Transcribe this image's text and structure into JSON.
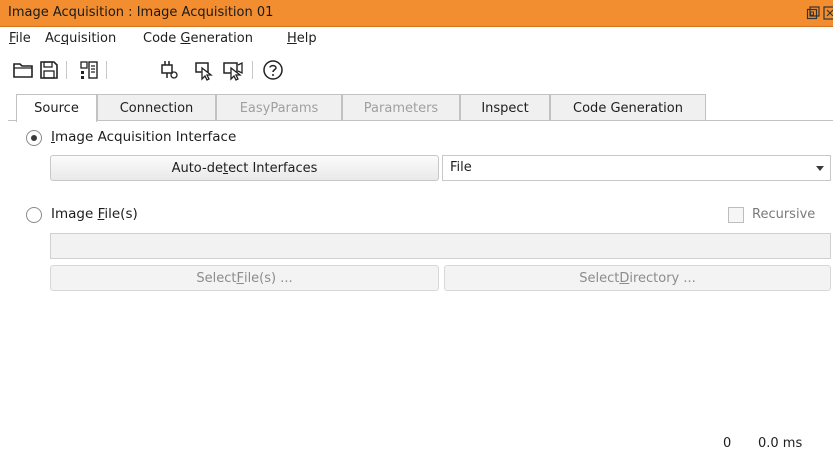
{
  "window": {
    "title": "Image Acquisition : Image Acquisition 01"
  },
  "menu": {
    "items": [
      {
        "label": "File",
        "mnemonic": "F"
      },
      {
        "label": "Acquisition",
        "mnemonic": "q"
      },
      {
        "label": "Code Generation",
        "mnemonic": "G"
      },
      {
        "label": "Help",
        "mnemonic": "H"
      }
    ]
  },
  "toolbar": {
    "icons": [
      "folder-open-icon",
      "save-icon",
      "document-layout-icon",
      "connect-plug-icon",
      "grab-single-icon",
      "grab-live-icon",
      "help-icon"
    ]
  },
  "tabs": [
    {
      "label": "Source",
      "state": "active"
    },
    {
      "label": "Connection",
      "state": "enabled"
    },
    {
      "label": "EasyParams",
      "state": "disabled"
    },
    {
      "label": "Parameters",
      "state": "disabled"
    },
    {
      "label": "Inspect",
      "state": "enabled"
    },
    {
      "label": "Code Generation",
      "state": "enabled"
    }
  ],
  "source": {
    "interface_radio": {
      "label_pre": "Image Acquisition Interface",
      "selected": true
    },
    "autodetect_button": {
      "pre": "Auto-de",
      "mn": "t",
      "post": "ect Interfaces"
    },
    "interface_combo": {
      "value": "File"
    },
    "files_radio": {
      "pre": "Image ",
      "mn": "F",
      "post": "ile(s)",
      "selected": false
    },
    "recursive_checkbox": {
      "label": "Recursive",
      "checked": false
    },
    "file_path_field": {
      "value": ""
    },
    "select_files_button": {
      "pre": "Select ",
      "mn": "F",
      "post": "ile(s) ..."
    },
    "select_directory_button": {
      "pre": "Select ",
      "mn": "D",
      "post": "irectory ..."
    }
  },
  "status": {
    "count": "0",
    "time": "0.0 ms"
  },
  "colors": {
    "titlebar": "#f28e30",
    "tab_border": "#c2c2c2"
  }
}
